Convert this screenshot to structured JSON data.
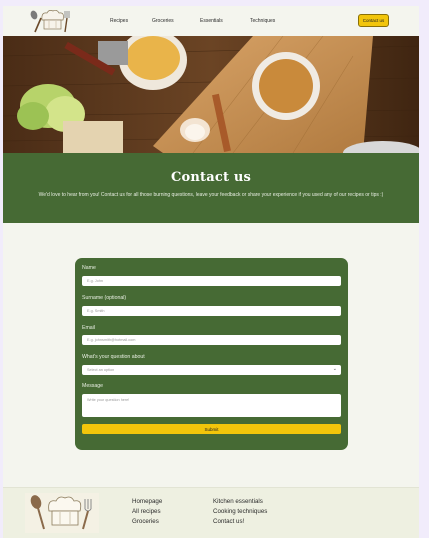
{
  "header": {
    "logo_icon": "chef-hat-utensils-icon",
    "nav": [
      "Recipes",
      "Groceries",
      "Essentials",
      "Techniques"
    ],
    "cta_label": "Contact us"
  },
  "hero": {
    "image": "kitchen-cutting-board-photo"
  },
  "banner": {
    "title": "Contact us",
    "text": "We'd love to hear from you! Contact us for all those burning questions, leave your feedback or share your experience if you used any of our recipes or tips :)"
  },
  "form": {
    "name_label": "Name",
    "name_placeholder": "E.g. John",
    "surname_label": "Surname (optional)",
    "surname_placeholder": "E.g. Smith",
    "email_label": "Email",
    "email_placeholder": "E.g. johnsmith@hotmail.com",
    "question_label": "What's your question about",
    "question_value": "Select an option",
    "message_label": "Message",
    "message_placeholder": "Write your question here!",
    "submit_label": "Submit"
  },
  "footer": {
    "logo_icon": "chef-hat-utensils-icon",
    "col1": [
      "Homepage",
      "All recipes",
      "Groceries"
    ],
    "col2": [
      "Kitchen essentials",
      "Cooking techniques",
      "Contact us!"
    ]
  },
  "colors": {
    "green": "#466a34",
    "yellow": "#f2c50b",
    "cream": "#f4f5ee"
  }
}
